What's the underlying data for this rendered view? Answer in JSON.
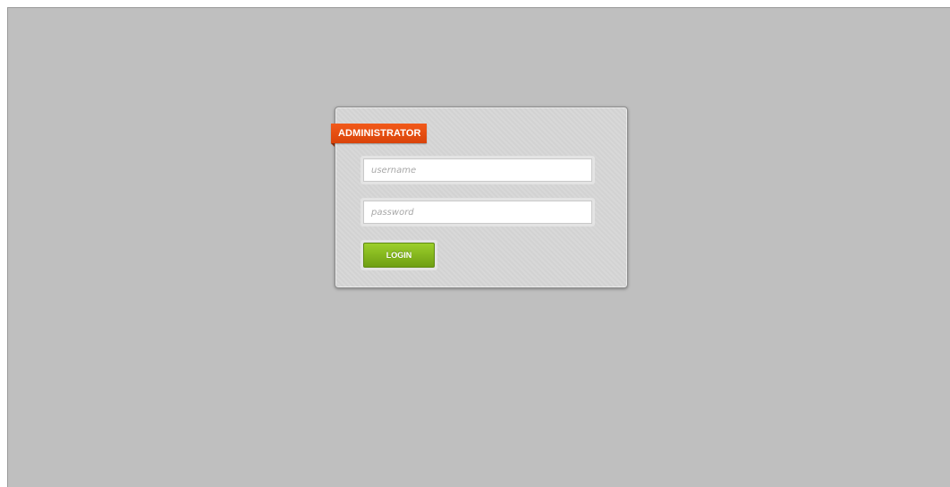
{
  "login": {
    "ribbon_label": "ADMINISTRATOR",
    "username_placeholder": "username",
    "password_placeholder": "password",
    "button_label": "LOGIN"
  },
  "colors": {
    "page_background": "#bfbfbf",
    "panel_background": "#d6d6d6",
    "ribbon_accent": "#e84e10",
    "button_accent": "#84b41c"
  }
}
